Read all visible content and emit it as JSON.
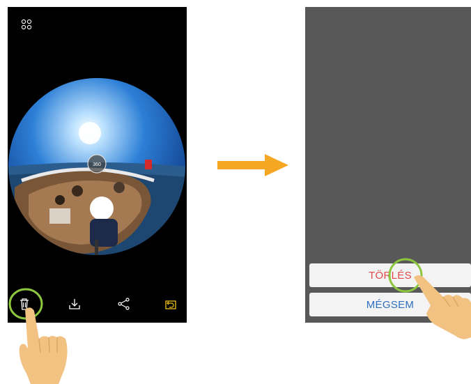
{
  "left_screen": {
    "toolbar": {
      "trash_icon": "trash-icon",
      "download_icon": "download-icon",
      "share_icon": "share-icon",
      "restore_icon": "restore-icon"
    },
    "photo_badge": "360"
  },
  "right_screen": {
    "delete_label": "TÖRLÉS",
    "cancel_label": "MÉGSEM"
  },
  "colors": {
    "highlight_ring": "#8cc63f",
    "arrow": "#f5a623",
    "delete_text": "#e2474b",
    "cancel_text": "#2f6fc0",
    "hand": "#f2c283"
  }
}
